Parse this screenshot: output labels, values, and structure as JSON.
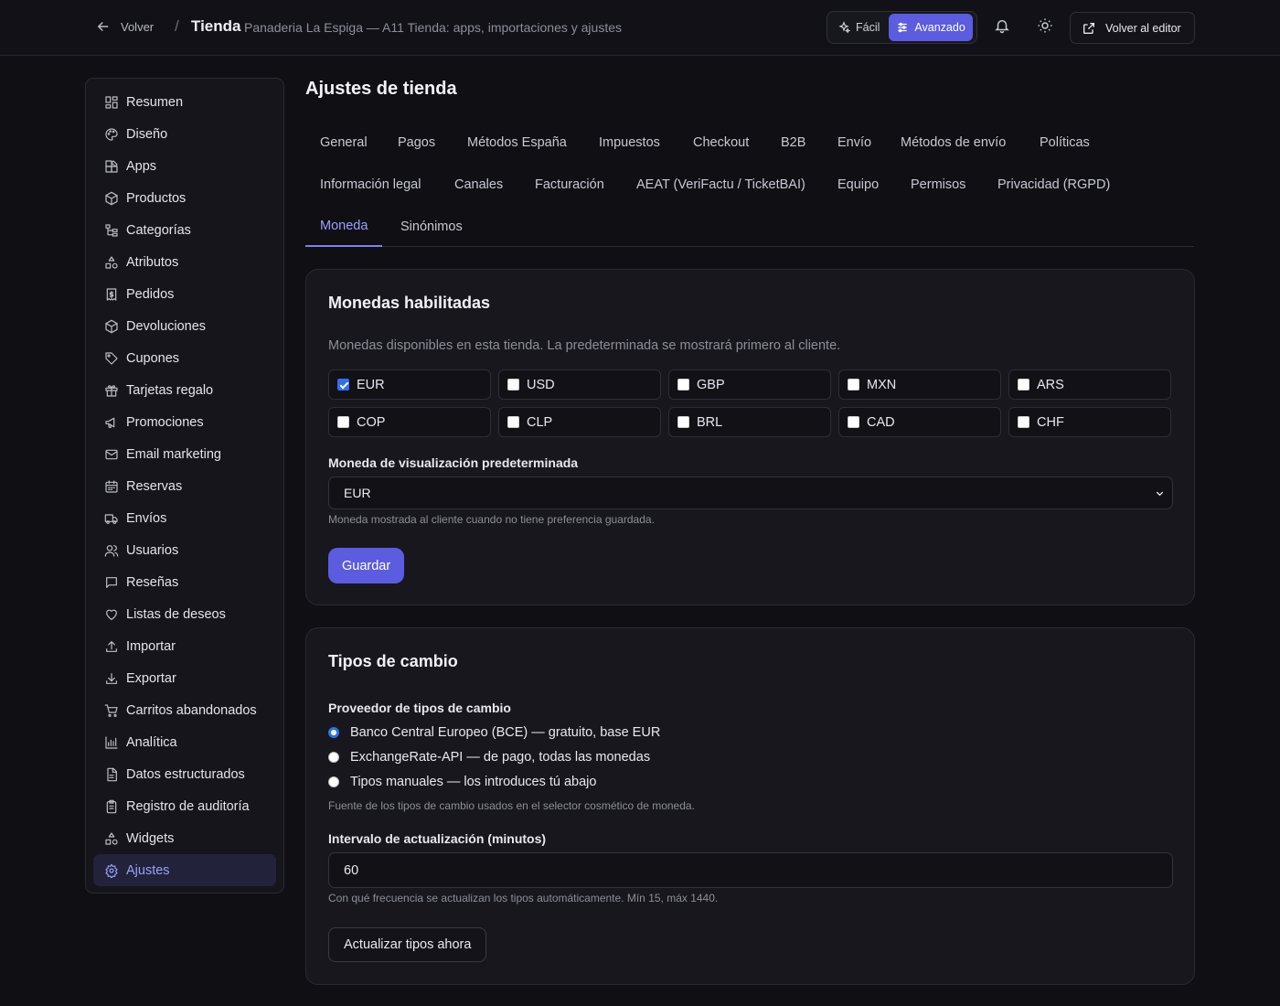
{
  "header": {
    "back_label": "Volver",
    "separator": "/",
    "title": "Tienda",
    "subtitle": "Panaderia La Espiga — A11 Tienda: apps, importaciones y ajustes",
    "mode_easy": "Fácil",
    "mode_advanced": "Avanzado",
    "mode_selected": "Avanzado",
    "editor_button": "Volver al editor",
    "accent_color": "#5b5ce0"
  },
  "sidebar": {
    "items": [
      {
        "label": "Resumen",
        "icon": "dashboard-icon"
      },
      {
        "label": "Diseño",
        "icon": "palette-icon"
      },
      {
        "label": "Apps",
        "icon": "apps-icon"
      },
      {
        "label": "Productos",
        "icon": "package-icon"
      },
      {
        "label": "Categorías",
        "icon": "hierarchy-icon"
      },
      {
        "label": "Atributos",
        "icon": "shapes-icon"
      },
      {
        "label": "Pedidos",
        "icon": "receipt-icon"
      },
      {
        "label": "Devoluciones",
        "icon": "box-return-icon"
      },
      {
        "label": "Cupones",
        "icon": "tag-icon"
      },
      {
        "label": "Tarjetas regalo",
        "icon": "gift-icon"
      },
      {
        "label": "Promociones",
        "icon": "megaphone-icon"
      },
      {
        "label": "Email marketing",
        "icon": "mail-icon"
      },
      {
        "label": "Reservas",
        "icon": "calendar-icon"
      },
      {
        "label": "Envíos",
        "icon": "truck-icon"
      },
      {
        "label": "Usuarios",
        "icon": "users-icon"
      },
      {
        "label": "Reseñas",
        "icon": "message-icon"
      },
      {
        "label": "Listas de deseos",
        "icon": "heart-icon"
      },
      {
        "label": "Importar",
        "icon": "upload-icon"
      },
      {
        "label": "Exportar",
        "icon": "download-icon"
      },
      {
        "label": "Carritos abandonados",
        "icon": "cart-icon"
      },
      {
        "label": "Analítica",
        "icon": "bar-chart-icon"
      },
      {
        "label": "Datos estructurados",
        "icon": "file-text-icon"
      },
      {
        "label": "Registro de auditoría",
        "icon": "clipboard-icon"
      },
      {
        "label": "Widgets",
        "icon": "shapes-icon"
      },
      {
        "label": "Ajustes",
        "icon": "gear-icon"
      }
    ],
    "active": "Ajustes"
  },
  "main": {
    "title": "Ajustes de tienda",
    "tabs": [
      "General",
      "Pagos",
      "Métodos España",
      "Impuestos",
      "Checkout",
      "B2B",
      "Envío",
      "Métodos de envío",
      "Políticas",
      "Información legal",
      "Canales",
      "Facturación",
      "AEAT (VeriFactu / TicketBAI)",
      "Equipo",
      "Permisos",
      "Privacidad (RGPD)",
      "Moneda",
      "Sinónimos"
    ],
    "active_tab": "Moneda"
  },
  "currencies": {
    "title": "Monedas habilitadas",
    "description": "Monedas disponibles en esta tienda. La predeterminada se mostrará primero al cliente.",
    "options": [
      {
        "code": "EUR",
        "checked": true
      },
      {
        "code": "USD",
        "checked": false
      },
      {
        "code": "GBP",
        "checked": false
      },
      {
        "code": "MXN",
        "checked": false
      },
      {
        "code": "ARS",
        "checked": false
      },
      {
        "code": "COP",
        "checked": false
      },
      {
        "code": "CLP",
        "checked": false
      },
      {
        "code": "BRL",
        "checked": false
      },
      {
        "code": "CAD",
        "checked": false
      },
      {
        "code": "CHF",
        "checked": false
      }
    ],
    "default_label": "Moneda de visualización predeterminada",
    "default_value": "EUR",
    "default_hint": "Moneda mostrada al cliente cuando no tiene preferencia guardada.",
    "save_label": "Guardar"
  },
  "exchange": {
    "title": "Tipos de cambio",
    "provider_label": "Proveedor de tipos de cambio",
    "providers": [
      {
        "label": "Banco Central Europeo (BCE) — gratuito, base EUR",
        "selected": true
      },
      {
        "label": "ExchangeRate-API — de pago, todas las monedas",
        "selected": false
      },
      {
        "label": "Tipos manuales — los introduces tú abajo",
        "selected": false
      }
    ],
    "provider_hint": "Fuente de los tipos de cambio usados en el selector cosmético de moneda.",
    "interval_label": "Intervalo de actualización (minutos)",
    "interval_value": "60",
    "interval_hint": "Con qué frecuencia se actualizan los tipos automáticamente. Mín 15, máx 1440.",
    "refresh_label": "Actualizar tipos ahora"
  }
}
